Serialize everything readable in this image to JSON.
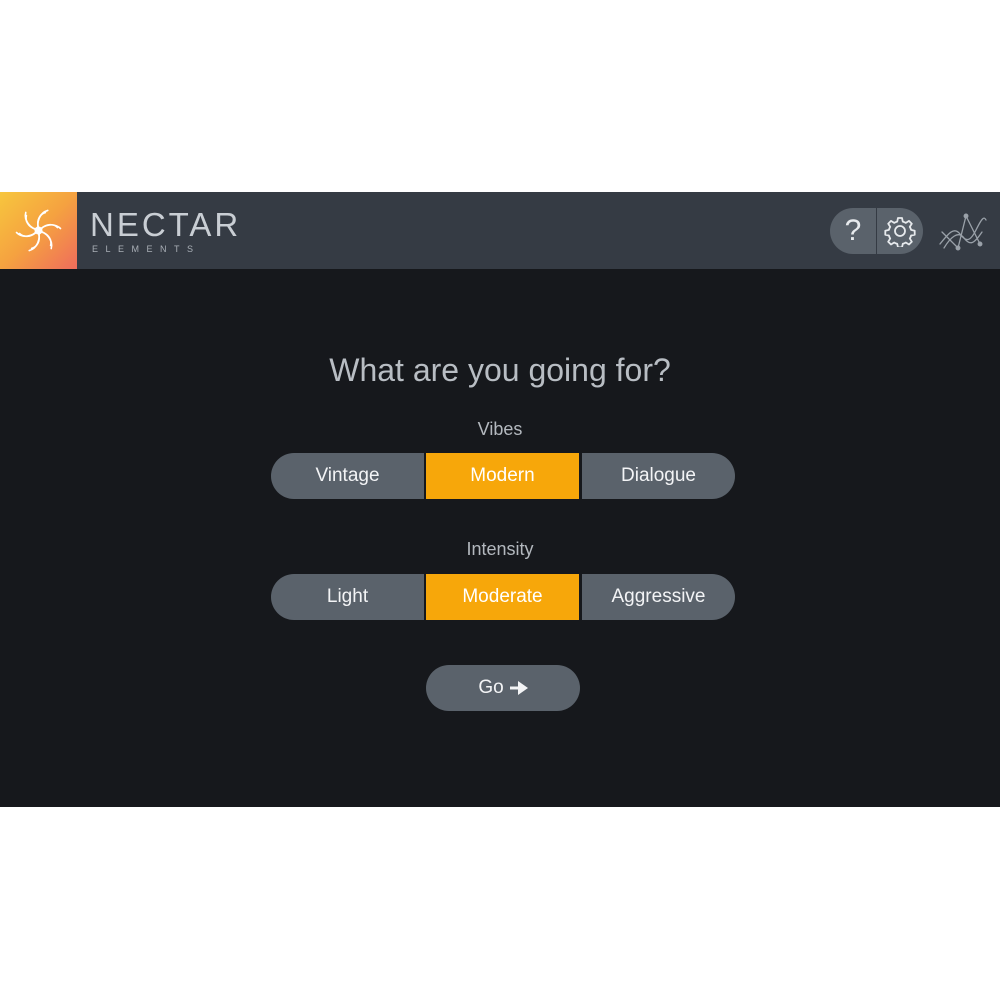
{
  "header": {
    "brand_name": "NECTAR",
    "brand_sub": "ELEMENTS",
    "help_label": "?",
    "icons": [
      "nectar-logo-icon",
      "help-icon",
      "gear-icon",
      "izotope-logo-icon"
    ]
  },
  "main": {
    "title": "What are you going for?",
    "vibes": {
      "label": "Vibes",
      "options": [
        "Vintage",
        "Modern",
        "Dialogue"
      ],
      "selected": "Modern"
    },
    "intensity": {
      "label": "Intensity",
      "options": [
        "Light",
        "Moderate",
        "Aggressive"
      ],
      "selected": "Moderate"
    },
    "go_label": "Go",
    "go_icon": "arrow-right-icon"
  },
  "colors": {
    "accent": "#f7a70a",
    "button": "#5a626b",
    "header": "#353b44",
    "background": "#16181c"
  }
}
